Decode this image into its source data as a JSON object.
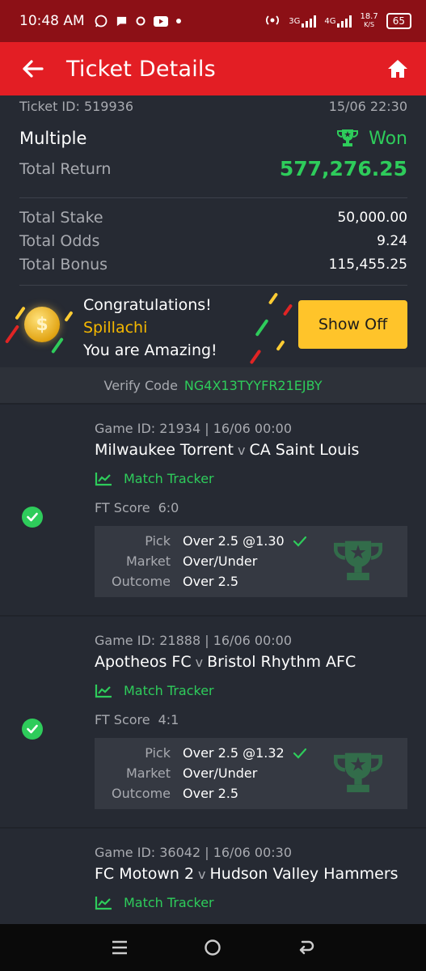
{
  "status_bar": {
    "time": "10:48 AM",
    "network_3g": "3G",
    "network_4g": "4G",
    "speed": "18.7",
    "speed_unit": "K/S",
    "battery": "65"
  },
  "header": {
    "title": "Ticket Details"
  },
  "ticket": {
    "id_label": "Ticket ID: 519936",
    "datetime": "15/06 22:30",
    "type": "Multiple",
    "status": "Won",
    "total_return_label": "Total Return",
    "total_return": "577,276.25",
    "total_stake_label": "Total Stake",
    "total_stake": "50,000.00",
    "total_odds_label": "Total Odds",
    "total_odds": "9.24",
    "total_bonus_label": "Total Bonus",
    "total_bonus": "115,455.25"
  },
  "promo": {
    "line1": "Congratulations!",
    "name": "Spillachi",
    "line3": "You are Amazing!",
    "button": "Show Off"
  },
  "verify": {
    "label": "Verify Code",
    "code": "NG4X13TYYFR21EJBY"
  },
  "games": [
    {
      "id_line": "Game ID: 21934 | 16/06 00:00",
      "home": "Milwaukee Torrent",
      "vs": "v",
      "away": "CA Saint Louis",
      "tracker": "Match Tracker",
      "ft_label": "FT Score",
      "ft_score": "6:0",
      "pick_label": "Pick",
      "pick": "Over 2.5 @1.30",
      "market_label": "Market",
      "market": "Over/Under",
      "outcome_label": "Outcome",
      "outcome": "Over 2.5"
    },
    {
      "id_line": "Game ID: 21888 | 16/06 00:00",
      "home": "Apotheos FC",
      "vs": "v",
      "away": "Bristol Rhythm AFC",
      "tracker": "Match Tracker",
      "ft_label": "FT Score",
      "ft_score": "4:1",
      "pick_label": "Pick",
      "pick": "Over 2.5 @1.32",
      "market_label": "Market",
      "market": "Over/Under",
      "outcome_label": "Outcome",
      "outcome": "Over 2.5"
    },
    {
      "id_line": "Game ID: 36042 | 16/06 00:30",
      "home": "FC Motown 2",
      "vs": "v",
      "away": "Hudson Valley Hammers",
      "tracker": "Match Tracker"
    }
  ],
  "colors": {
    "status_bar": "#8c1016",
    "header": "#e31e24",
    "background": "#262a33",
    "accent_green": "#2ecc5b",
    "button_yellow": "#ffc42a",
    "name_yellow": "#f5b800"
  },
  "icons": [
    "back-arrow-icon",
    "home-icon",
    "trophy-icon",
    "chart-icon",
    "check-icon",
    "menu-icon",
    "home-circle-icon",
    "back-nav-icon"
  ]
}
